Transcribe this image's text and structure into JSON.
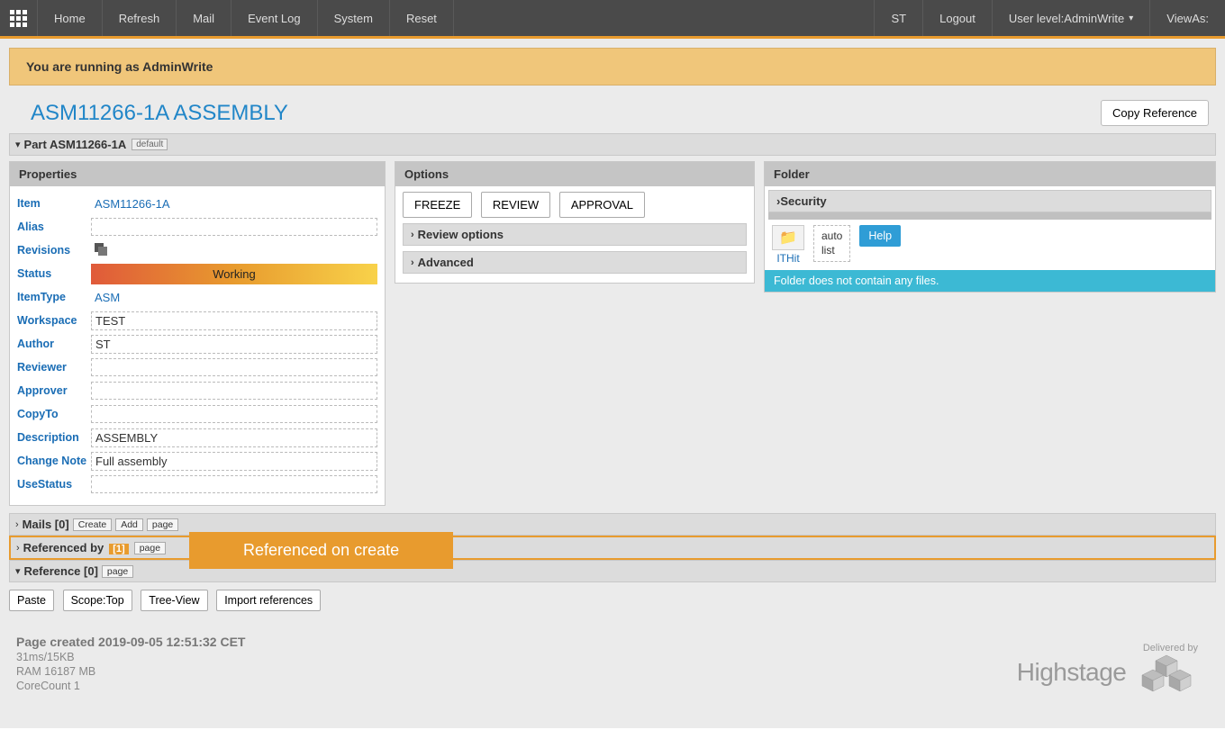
{
  "nav": {
    "items": [
      "Home",
      "Refresh",
      "Mail",
      "Event Log",
      "System",
      "Reset"
    ],
    "user_short": "ST",
    "logout": "Logout",
    "user_level_label": "User level:AdminWrite",
    "view_as": "ViewAs:"
  },
  "banner": "You are running as AdminWrite",
  "page_title": "ASM11266-1A ASSEMBLY",
  "copy_ref": "Copy Reference",
  "part_section": {
    "label": "Part ASM11266-1A",
    "tag": "default"
  },
  "properties": {
    "header": "Properties",
    "rows": {
      "item": {
        "label": "Item",
        "value": "ASM11266-1A"
      },
      "alias": {
        "label": "Alias",
        "value": ""
      },
      "revisions": {
        "label": "Revisions"
      },
      "status": {
        "label": "Status",
        "value": "Working"
      },
      "itemtype": {
        "label": "ItemType",
        "value": "ASM"
      },
      "workspace": {
        "label": "Workspace",
        "value": "TEST"
      },
      "author": {
        "label": "Author",
        "value": "ST"
      },
      "reviewer": {
        "label": "Reviewer",
        "value": ""
      },
      "approver": {
        "label": "Approver",
        "value": ""
      },
      "copyto": {
        "label": "CopyTo",
        "value": ""
      },
      "description": {
        "label": "Description",
        "value": "ASSEMBLY"
      },
      "changenote": {
        "label": "Change Note",
        "value": "Full assembly"
      },
      "usestatus": {
        "label": "UseStatus",
        "value": ""
      }
    }
  },
  "options": {
    "header": "Options",
    "buttons": [
      "FREEZE",
      "REVIEW",
      "APPROVAL"
    ],
    "subs": [
      "Review options",
      "Advanced"
    ]
  },
  "folder": {
    "header": "Folder",
    "security": "Security",
    "ithit": "ITHit",
    "auto": "auto",
    "list": "list",
    "help": "Help",
    "msg": "Folder does not contain any files."
  },
  "mails": {
    "label": "Mails [0]",
    "create": "Create",
    "add": "Add",
    "page": "page"
  },
  "refby": {
    "label": "Referenced by",
    "count": "[1]",
    "page": "page"
  },
  "annotation": "Referenced on create",
  "reference": {
    "label": "Reference [0]",
    "page": "page"
  },
  "toolbar": {
    "paste": "Paste",
    "scope": "Scope:Top",
    "tree": "Tree-View",
    "import": "Import references"
  },
  "footer": {
    "created": "Page created 2019-09-05 12:51:32 CET",
    "timing": "31ms/15KB",
    "ram": "RAM 16187 MB",
    "core": "CoreCount 1",
    "delivered": "Delivered by",
    "brand": "Highstage"
  }
}
